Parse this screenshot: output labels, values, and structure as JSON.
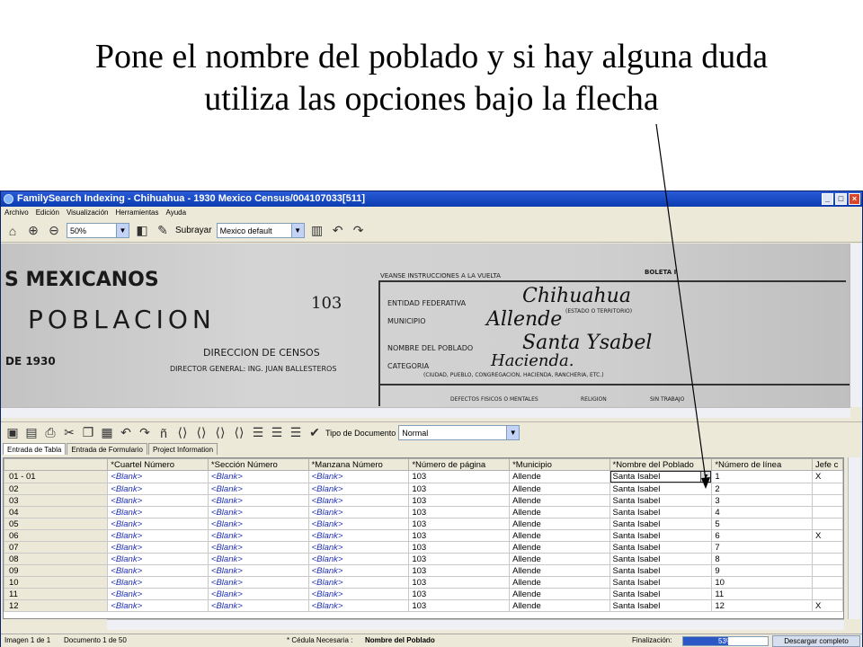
{
  "caption": {
    "line1": "Pone el nombre del poblado y si hay alguna duda",
    "line2": "utiliza las opciones bajo la flecha"
  },
  "window": {
    "title": "FamilySearch Indexing - Chihuahua - 1930 Mexico Census/004107033[511]",
    "controls": {
      "minimize": "_",
      "maximize": "□",
      "close": "×"
    }
  },
  "menu": [
    "Archivo",
    "Edición",
    "Visualización",
    "Herramientas",
    "Ayuda"
  ],
  "toolbar": {
    "zoom_value": "50%",
    "underline_label": "Subrayar",
    "underline_value": "Mexico default"
  },
  "document": {
    "left_header1": "S  MEXICANOS",
    "left_header2": "POBLACION",
    "number": "103",
    "year": "DE 1930",
    "direccion": "DIRECCION DE CENSOS",
    "director": "DIRECTOR GENERAL: ING. JUAN BALLESTEROS",
    "instrucciones": "VEANSE INSTRUCCIONES A LA VUELTA",
    "boleta": "BOLETA I",
    "entidad": "ENTIDAD FEDERATIVA",
    "estado": "(ESTADO O TERRITORIO)",
    "municipio": "MUNICIPIO",
    "nombre_poblado": "NOMBRE DEL POBLADO",
    "categoria": "CATEGORIA",
    "categoria_opts": "(CIUDAD, PUEBLO, CONGREGACION, HACIENDA, RANCHERIA, ETC.)",
    "hw_entidad": "Chihuahua",
    "hw_municipio": "Allende",
    "hw_poblado": "Santa Ysabel",
    "hw_categoria": "Hacienda.",
    "col_defectos": "DEFECTOS FISICOS O MENTALES",
    "col_religion": "RELIGION",
    "col_sin_trabajo": "SIN TRABAJO"
  },
  "toolbar2": {
    "doc_type_label": "Tipo de Documento",
    "doc_type_value": "Normal"
  },
  "tabs": [
    "Entrada de Tabla",
    "Entrada de Formulario",
    "Project Information"
  ],
  "table": {
    "headers": [
      "*Cuartel Número",
      "*Sección Número",
      "*Manzana Número",
      "*Número de página",
      "*Municipio",
      "*Nombre del Poblado",
      "*Número de línea",
      "Jefe c"
    ],
    "rows": [
      {
        "id": "01 - 01",
        "c1": "<Blank>",
        "c2": "<Blank>",
        "c3": "<Blank>",
        "page": "103",
        "mun": "Allende",
        "pob": "Santa Isabel",
        "line": "1",
        "jefe": "X"
      },
      {
        "id": "02",
        "c1": "<Blank>",
        "c2": "<Blank>",
        "c3": "<Blank>",
        "page": "103",
        "mun": "Allende",
        "pob": "Santa Isabel",
        "line": "2",
        "jefe": ""
      },
      {
        "id": "03",
        "c1": "<Blank>",
        "c2": "<Blank>",
        "c3": "<Blank>",
        "page": "103",
        "mun": "Allende",
        "pob": "Santa Isabel",
        "line": "3",
        "jefe": ""
      },
      {
        "id": "04",
        "c1": "<Blank>",
        "c2": "<Blank>",
        "c3": "<Blank>",
        "page": "103",
        "mun": "Allende",
        "pob": "Santa Isabel",
        "line": "4",
        "jefe": ""
      },
      {
        "id": "05",
        "c1": "<Blank>",
        "c2": "<Blank>",
        "c3": "<Blank>",
        "page": "103",
        "mun": "Allende",
        "pob": "Santa Isabel",
        "line": "5",
        "jefe": ""
      },
      {
        "id": "06",
        "c1": "<Blank>",
        "c2": "<Blank>",
        "c3": "<Blank>",
        "page": "103",
        "mun": "Allende",
        "pob": "Santa Isabel",
        "line": "6",
        "jefe": "X"
      },
      {
        "id": "07",
        "c1": "<Blank>",
        "c2": "<Blank>",
        "c3": "<Blank>",
        "page": "103",
        "mun": "Allende",
        "pob": "Santa Isabel",
        "line": "7",
        "jefe": ""
      },
      {
        "id": "08",
        "c1": "<Blank>",
        "c2": "<Blank>",
        "c3": "<Blank>",
        "page": "103",
        "mun": "Allende",
        "pob": "Santa Isabel",
        "line": "8",
        "jefe": ""
      },
      {
        "id": "09",
        "c1": "<Blank>",
        "c2": "<Blank>",
        "c3": "<Blank>",
        "page": "103",
        "mun": "Allende",
        "pob": "Santa Isabel",
        "line": "9",
        "jefe": ""
      },
      {
        "id": "10",
        "c1": "<Blank>",
        "c2": "<Blank>",
        "c3": "<Blank>",
        "page": "103",
        "mun": "Allende",
        "pob": "Santa Isabel",
        "line": "10",
        "jefe": ""
      },
      {
        "id": "11",
        "c1": "<Blank>",
        "c2": "<Blank>",
        "c3": "<Blank>",
        "page": "103",
        "mun": "Allende",
        "pob": "Santa Isabel",
        "line": "11",
        "jefe": ""
      },
      {
        "id": "12",
        "c1": "<Blank>",
        "c2": "<Blank>",
        "c3": "<Blank>",
        "page": "103",
        "mun": "Allende",
        "pob": "Santa Isabel",
        "line": "12",
        "jefe": "X"
      }
    ]
  },
  "status": {
    "imagen": "Imagen 1 de 1",
    "documento": "Documento 1 de 50",
    "required_prefix": "* Cédula Necesaria :",
    "required_field": "Nombre del Poblado",
    "finalizacion_label": "Finalización:",
    "progress_pct": "53%",
    "progress_fraction": 0.53,
    "download_button": "Descargar completo"
  },
  "colors": {
    "titlebar": "#0a3cb0",
    "blank_text": "#1f2fb5",
    "progress_fill": "#2c58c6"
  }
}
